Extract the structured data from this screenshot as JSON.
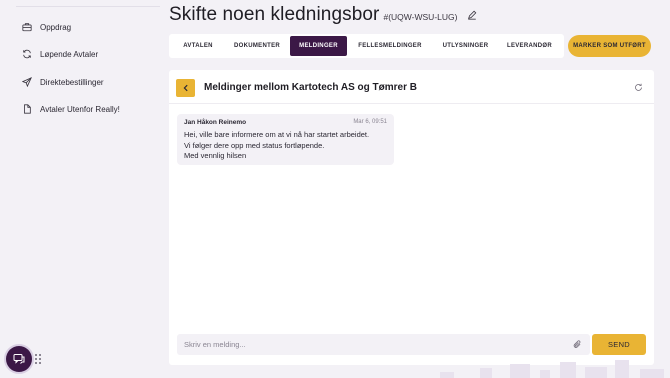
{
  "sidebar": {
    "items": [
      {
        "label": "Oppdrag",
        "icon": "briefcase-icon"
      },
      {
        "label": "Løpende Avtaler",
        "icon": "refresh-cycle-icon"
      },
      {
        "label": "Direktebestillinger",
        "icon": "send-icon"
      },
      {
        "label": "Avtaler Utenfor Really!",
        "icon": "document-icon"
      }
    ]
  },
  "header": {
    "title": "Skifte noen kledningsbor",
    "code": "#(UQW-WSU-LUG)"
  },
  "tabs": [
    {
      "label": "AVTALEN"
    },
    {
      "label": "DOKUMENTER"
    },
    {
      "label": "MELDINGER",
      "active": true
    },
    {
      "label": "FELLESMELDINGER"
    },
    {
      "label": "UTLYSNINGER"
    },
    {
      "label": "LEVERANDØR"
    }
  ],
  "mark_button": {
    "label": "MARKER SOM UTFØRT"
  },
  "conversation": {
    "title": "Meldinger mellom Kartotech AS og Tømrer B",
    "messages": [
      {
        "author": "Jan Håkon Reinemo",
        "time": "Mar 6, 09:51",
        "lines": [
          "Hei, ville bare informere om at vi nå har startet arbeidet.",
          "Vi følger dere opp med status fortløpende.",
          "Med vennlig hilsen"
        ]
      }
    ],
    "input": {
      "placeholder": "Skriv en melding...",
      "value": ""
    },
    "send_label": "SEND"
  },
  "colors": {
    "accent": "#e9b434",
    "brand": "#3b1846",
    "background": "#f3f1f6"
  }
}
